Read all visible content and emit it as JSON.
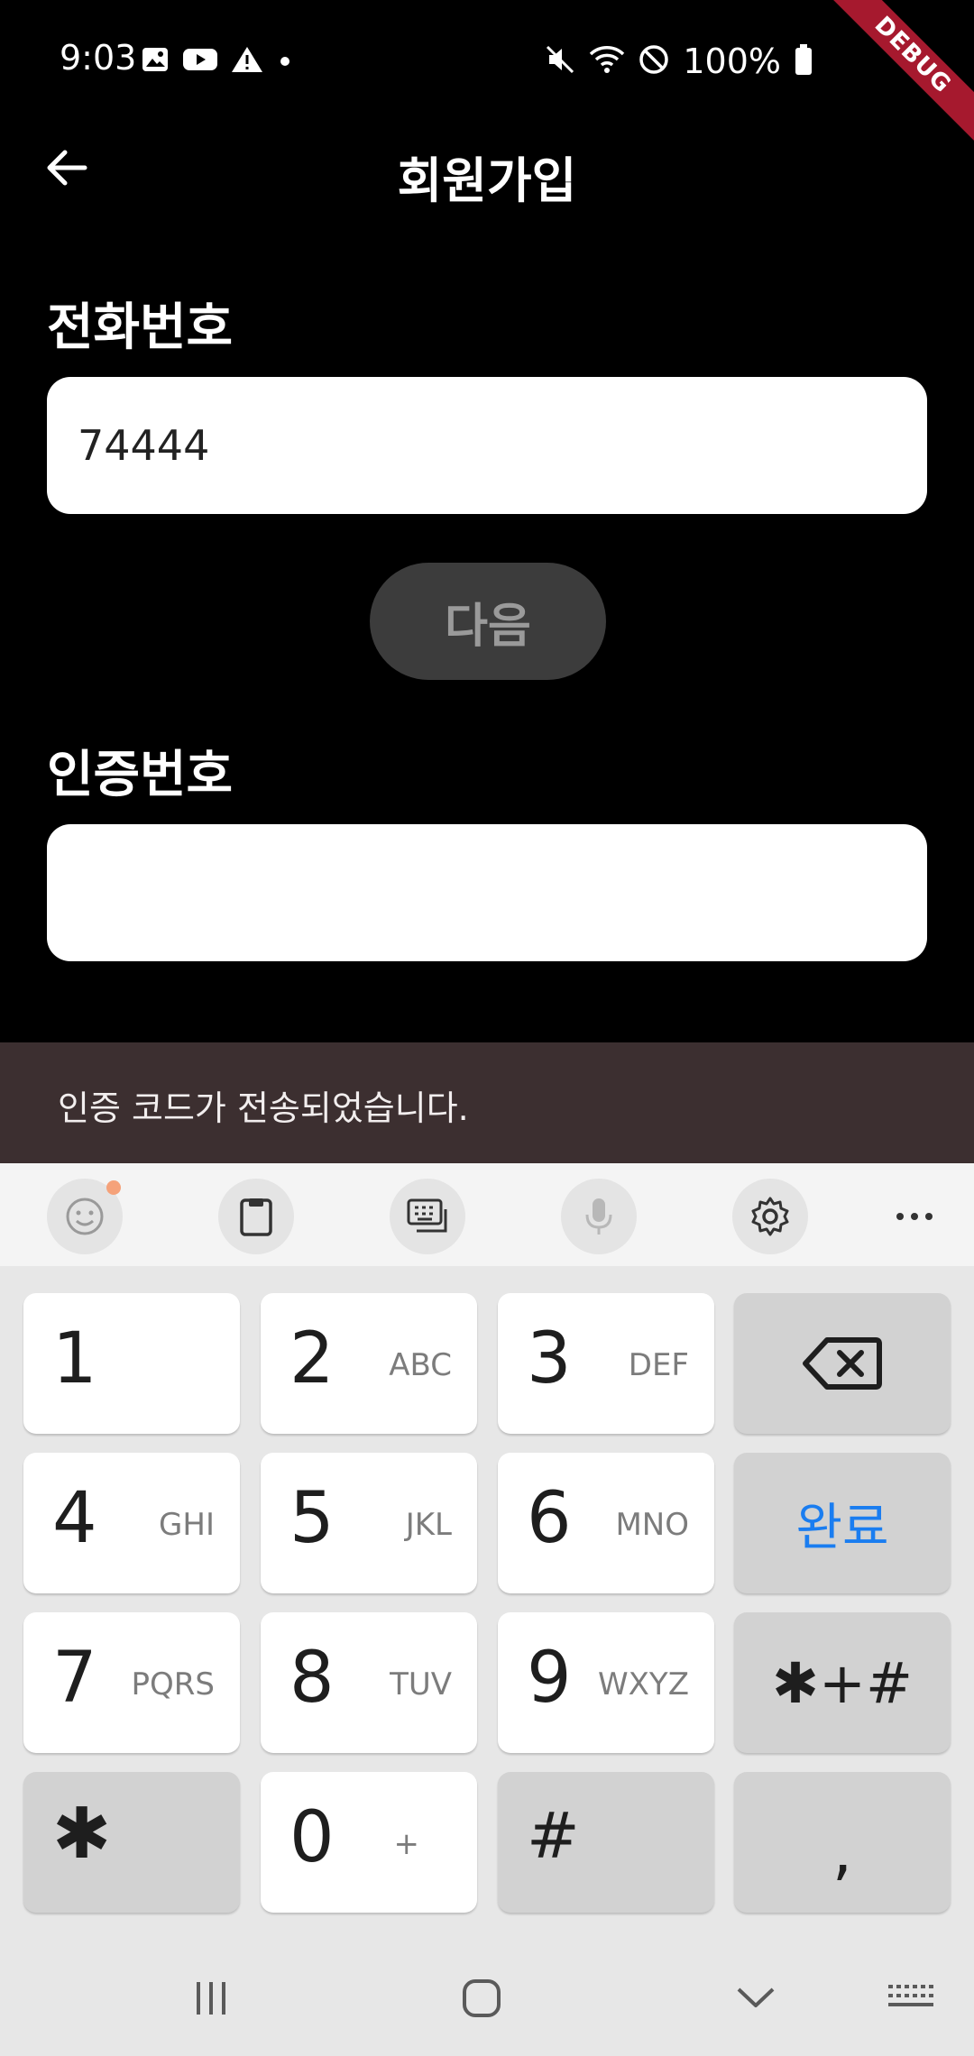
{
  "status_bar": {
    "time": "9:03",
    "battery": "100%",
    "left_icons": [
      "image-icon",
      "youtube-icon",
      "warning-icon",
      "dot-icon"
    ],
    "right_icons": [
      "mute-icon",
      "wifi-icon",
      "do-not-disturb-icon",
      "battery-icon"
    ]
  },
  "debug_banner": "DEBUG",
  "app_bar": {
    "title": "회원가입"
  },
  "phone_section": {
    "label": "전화번호",
    "value": "74444"
  },
  "next_button": {
    "label": "다음"
  },
  "code_section": {
    "label": "인증번호",
    "value": ""
  },
  "snackbar": {
    "message": "인증 코드가 전송되었습니다."
  },
  "keyboard": {
    "toolbar": [
      "emoji-icon",
      "clipboard-icon",
      "keyboard-layout-icon",
      "microphone-icon",
      "settings-icon",
      "more-icon"
    ],
    "rows": [
      [
        {
          "digit": "1",
          "letters": ""
        },
        {
          "digit": "2",
          "letters": "ABC"
        },
        {
          "digit": "3",
          "letters": "DEF"
        }
      ],
      [
        {
          "digit": "4",
          "letters": "GHI"
        },
        {
          "digit": "5",
          "letters": "JKL"
        },
        {
          "digit": "6",
          "letters": "MNO"
        }
      ],
      [
        {
          "digit": "7",
          "letters": "PQRS"
        },
        {
          "digit": "8",
          "letters": "TUV"
        },
        {
          "digit": "9",
          "letters": "WXYZ"
        }
      ]
    ],
    "bottom_row": {
      "star": "✱",
      "zero": "0",
      "zero_sub": "+",
      "hash": "#",
      "comma": ","
    },
    "side_keys": {
      "backspace": "backspace-icon",
      "done": "완료",
      "symbols": "✱+#"
    }
  },
  "nav_bar": [
    "recent-apps-icon",
    "home-icon",
    "hide-keyboard-icon",
    "keyboard-switch-icon"
  ],
  "colors": {
    "accent": "#1a7df0",
    "snackbar": "#3c2f30",
    "debug": "#a6192e",
    "button_disabled": "#3c3c3c"
  }
}
